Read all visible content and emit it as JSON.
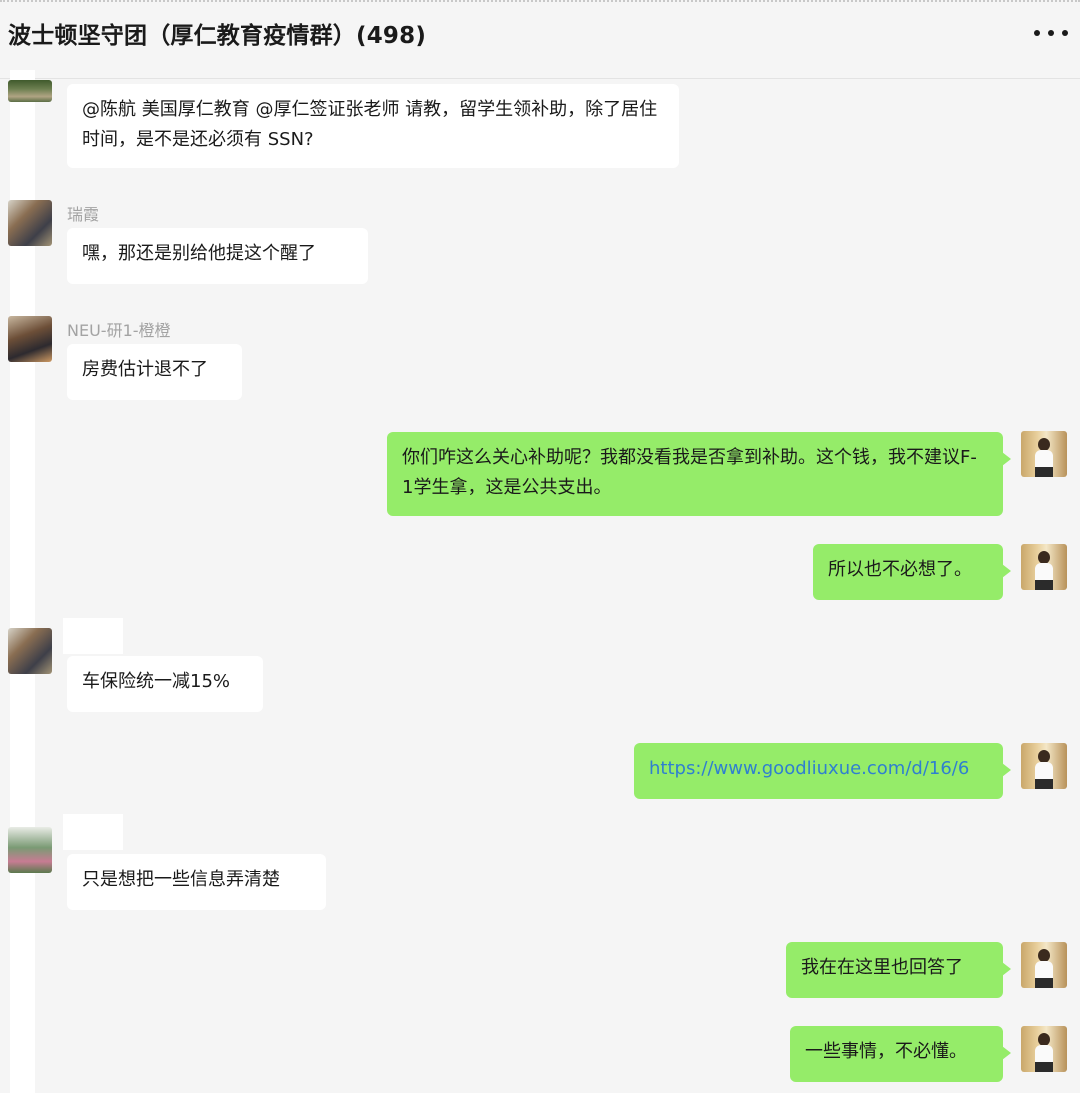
{
  "header": {
    "title": "波士顿坚守团（厚仁教育疫情群）(498)",
    "more_icon": "more-dots-icon"
  },
  "messages": [
    {
      "side": "left",
      "sender": "",
      "text": "@陈航 美国厚仁教育 @厚仁签证张老师 请教，留学生领补助，除了居住时间，是不是还必须有 SSN?"
    },
    {
      "side": "left",
      "sender": "瑞霞",
      "text": "嘿，那还是别给他提这个醒了"
    },
    {
      "side": "left",
      "sender": "NEU-研1-橙橙",
      "text": "房费估计退不了"
    },
    {
      "side": "right",
      "sender": "",
      "text": "你们咋这么关心补助呢？我都没看我是否拿到补助。这个钱，我不建议F-1学生拿，这是公共支出。"
    },
    {
      "side": "right",
      "sender": "",
      "text": "所以也不必想了。"
    },
    {
      "side": "left",
      "sender": "",
      "text": "车保险统一减15%"
    },
    {
      "side": "right",
      "sender": "",
      "text": "https://www.goodliuxue.com/d/16/6"
    },
    {
      "side": "left",
      "sender": "",
      "text": "只是想把一些信息弄清楚"
    },
    {
      "side": "right",
      "sender": "",
      "text": "我在在这里也回答了"
    },
    {
      "side": "right",
      "sender": "",
      "text": "一些事情，不必懂。"
    }
  ],
  "colors": {
    "background": "#f5f5f5",
    "incoming_bubble": "#ffffff",
    "outgoing_bubble": "#95ec69",
    "link": "#2f7fd0",
    "sender_name": "#a3a3a3"
  }
}
